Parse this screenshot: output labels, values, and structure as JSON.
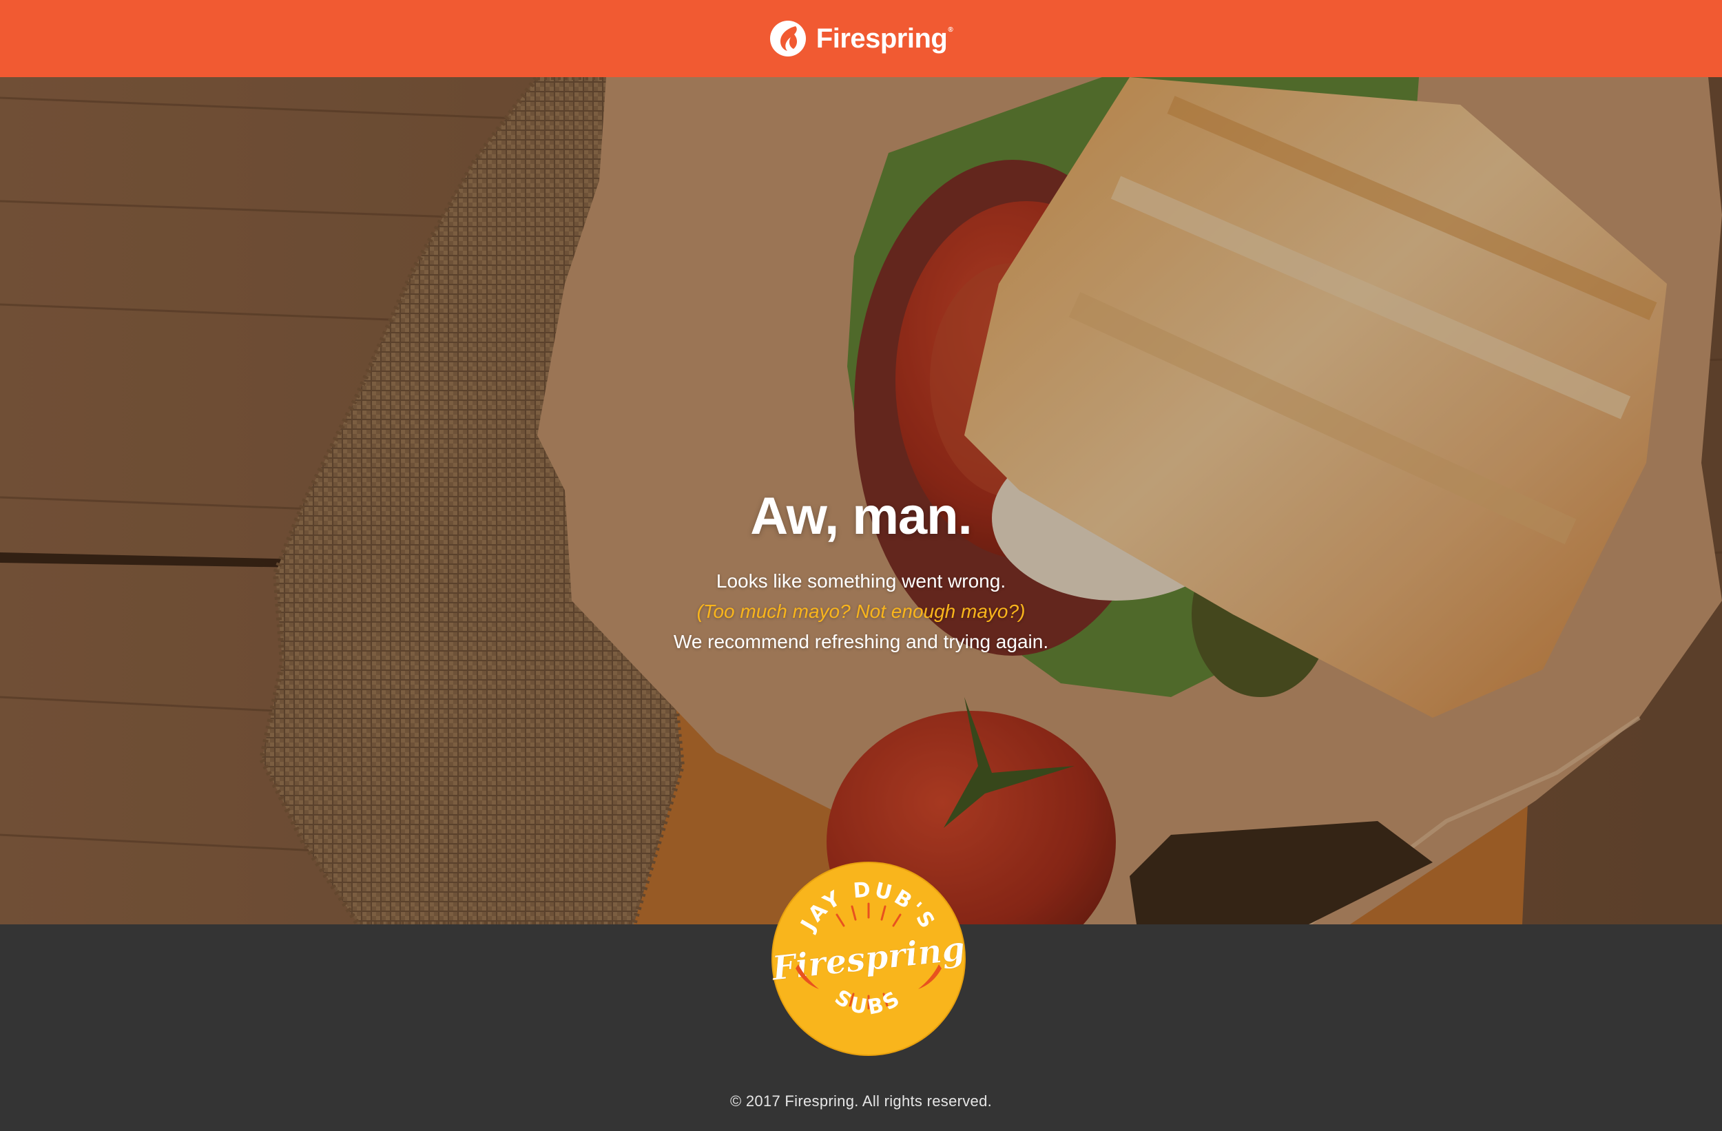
{
  "header": {
    "brand_name": "Firespring",
    "brand_icon": "firespring-flame-icon",
    "color": "#f15a32"
  },
  "hero": {
    "heading": "Aw, man.",
    "line1": "Looks like something went wrong.",
    "line2": "(Too much mayo? Not enough mayo?)",
    "line3": "We recommend refreshing and trying again.",
    "accent_color": "#f9b51c"
  },
  "badge": {
    "top_text": "JAY DUB'S",
    "script_text": "Firespring",
    "bottom_text": "SUBS",
    "color": "#f9b51c"
  },
  "footer": {
    "copyright": "© 2017 Firespring. All rights reserved.",
    "color": "#343434"
  }
}
